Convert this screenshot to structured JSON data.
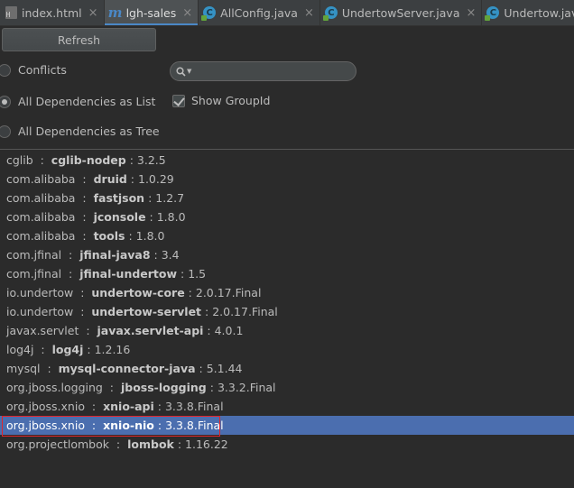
{
  "tabs": [
    {
      "label": "index.html",
      "icon": "html-file-icon",
      "close": "×"
    },
    {
      "label": "lgh-sales",
      "icon": "maven-module-icon",
      "close": "×",
      "active": true
    },
    {
      "label": "AllConfig.java",
      "icon": "java-class-icon",
      "close": "×"
    },
    {
      "label": "UndertowServer.java",
      "icon": "java-class-icon",
      "close": "×"
    },
    {
      "label": "Undertow.java",
      "icon": "java-class-icon",
      "close": "×"
    }
  ],
  "toolbar": {
    "refresh_label": "Refresh"
  },
  "options": {
    "conflicts_label": "Conflicts",
    "all_list_label": "All Dependencies as List",
    "all_tree_label": "All Dependencies as Tree",
    "selected_mode": "All Dependencies as List",
    "show_groupid_label": "Show GroupId",
    "show_groupid_checked": true
  },
  "search": {
    "value": "",
    "placeholder": ""
  },
  "dependencies": [
    {
      "group": "cglib",
      "artifact": "cglib-nodep",
      "version": "3.2.5"
    },
    {
      "group": "com.alibaba",
      "artifact": "druid",
      "version": "1.0.29"
    },
    {
      "group": "com.alibaba",
      "artifact": "fastjson",
      "version": "1.2.7"
    },
    {
      "group": "com.alibaba",
      "artifact": "jconsole",
      "version": "1.8.0"
    },
    {
      "group": "com.alibaba",
      "artifact": "tools",
      "version": "1.8.0"
    },
    {
      "group": "com.jfinal",
      "artifact": "jfinal-java8",
      "version": "3.4"
    },
    {
      "group": "com.jfinal",
      "artifact": "jfinal-undertow",
      "version": "1.5"
    },
    {
      "group": "io.undertow",
      "artifact": "undertow-core",
      "version": "2.0.17.Final"
    },
    {
      "group": "io.undertow",
      "artifact": "undertow-servlet",
      "version": "2.0.17.Final"
    },
    {
      "group": "javax.servlet",
      "artifact": "javax.servlet-api",
      "version": "4.0.1"
    },
    {
      "group": "log4j",
      "artifact": "log4j",
      "version": "1.2.16"
    },
    {
      "group": "mysql",
      "artifact": "mysql-connector-java",
      "version": "5.1.44"
    },
    {
      "group": "org.jboss.logging",
      "artifact": "jboss-logging",
      "version": "3.3.2.Final"
    },
    {
      "group": "org.jboss.xnio",
      "artifact": "xnio-api",
      "version": "3.3.8.Final"
    },
    {
      "group": "org.jboss.xnio",
      "artifact": "xnio-nio",
      "version": "3.3.8.Final",
      "selected": true
    },
    {
      "group": "org.projectlombok",
      "artifact": "lombok",
      "version": "1.16.22"
    }
  ],
  "colors": {
    "background": "#2b2b2b",
    "selection": "#4b6eaf",
    "highlight_box": "#e0252b",
    "active_tab_underline": "#4a88c7"
  }
}
